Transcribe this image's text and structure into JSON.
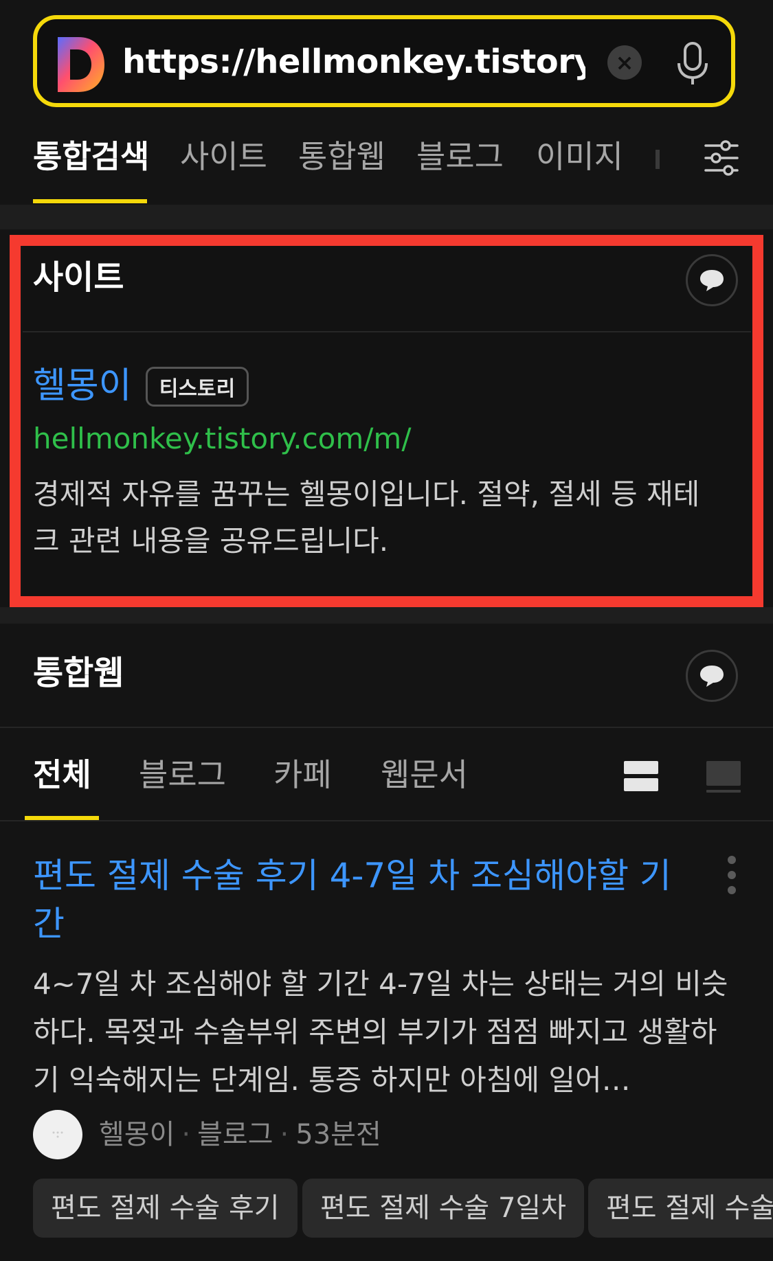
{
  "search": {
    "url": "https://hellmonkey.tistory.com/m/",
    "clear_label": "×"
  },
  "tabs": [
    "통합검색",
    "사이트",
    "통합웹",
    "블로그",
    "이미지"
  ],
  "site_section": {
    "title": "사이트",
    "result": {
      "name": "헬몽이",
      "badge": "티스토리",
      "url": "hellmonkey.tistory.com/m/",
      "description": "경제적 자유를 꿈꾸는 헬몽이입니다. 절약, 절세 등 재테크 관련 내용을 공유드립니다."
    }
  },
  "web_section": {
    "title": "통합웹",
    "subtabs": [
      "전체",
      "블로그",
      "카페",
      "웹문서"
    ],
    "result": {
      "title": "편도 절제 수술 후기 4-7일 차 조심해야할 기간",
      "snippet": "4~7일 차 조심해야 할 기간 4-7일 차는 상태는 거의 비슷하다. 목젖과 수술부위 주변의 부기가 점점 빠지고 생활하기 익숙해지는 단계임. 통증 하지만 아침에 일어…",
      "author": "헬몽이",
      "source": "블로그",
      "time": "53분전"
    },
    "related": [
      "편도 절제 수술 후기",
      "편도 절제 수술 7일차",
      "편도 절제 수술"
    ]
  },
  "colors": {
    "accent_yellow": "#f5d90a",
    "highlight_red": "#f53a2f",
    "link_blue": "#3d96ff",
    "url_green": "#2fbf4a"
  },
  "icons": [
    "d-logo-icon",
    "clear-icon",
    "mic-icon",
    "filter-icon",
    "speech-bubble-icon",
    "list-view-icon",
    "card-view-icon",
    "kebab-menu-icon"
  ]
}
